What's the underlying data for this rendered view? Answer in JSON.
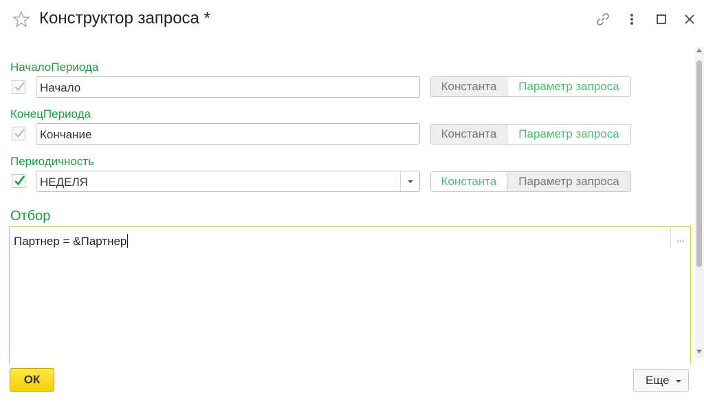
{
  "window": {
    "title": "Конструктор запроса *"
  },
  "fields": [
    {
      "label": "НачалоПериода",
      "checked": true,
      "check_style": "gray",
      "value": "Начало",
      "dropdown": false,
      "constant_label": "Константа",
      "parameter_label": "Параметр запроса",
      "selected": "constant"
    },
    {
      "label": "КонецПериода",
      "checked": true,
      "check_style": "gray",
      "value": "Кончание",
      "dropdown": false,
      "constant_label": "Константа",
      "parameter_label": "Параметр запроса",
      "selected": "constant"
    },
    {
      "label": "Периодичность",
      "checked": true,
      "check_style": "green",
      "value": "НЕДЕЛЯ",
      "dropdown": true,
      "constant_label": "Константа",
      "parameter_label": "Параметр запроса",
      "selected": "parameter"
    }
  ],
  "filter": {
    "label": "Отбор",
    "text": "Партнер = &Партнер",
    "button_label": "..."
  },
  "footer": {
    "ok_label": "ОК",
    "more_label": "Еще"
  },
  "colors": {
    "label_green": "#1e9a44",
    "accent_yellow": "#f5d200",
    "toggle_active_green": "#4cbb73"
  }
}
